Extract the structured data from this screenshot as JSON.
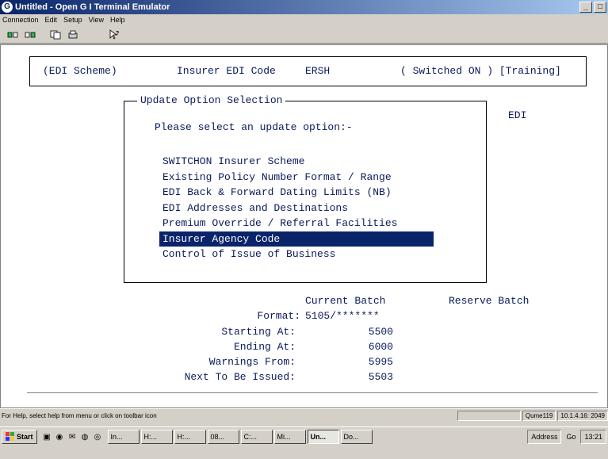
{
  "window": {
    "title": "Untitled - Open G I Terminal Emulator",
    "minimize": "_",
    "maximize": "□"
  },
  "menu": [
    "Connection",
    "Edit",
    "Setup",
    "View",
    "Help"
  ],
  "toolbar": [
    "connect-icon",
    "disconnect-icon",
    "copy-icon",
    "print-icon",
    "help-cursor-icon"
  ],
  "screen": {
    "header": {
      "scheme": "(EDI Scheme)",
      "code_label": "Insurer EDI Code",
      "code": "ERSH",
      "status": "( Switched ON ) [Training]"
    },
    "dialog": {
      "title": "Update Option Selection",
      "prompt": "Please select an update option:-",
      "side_label": "EDI",
      "options": [
        "SWITCHON Insurer Scheme",
        "Existing Policy Number Format / Range",
        "EDI Back & Forward Dating Limits (NB)",
        "EDI Addresses and Destinations",
        "Premium Override / Referral Facilities",
        "Insurer Agency Code",
        "Control of Issue of Business"
      ],
      "selected_index": 5
    },
    "batch": {
      "current_header": "Current Batch",
      "reserve_header": "Reserve Batch",
      "format_label": "Format:",
      "format_value": "5105/*******",
      "rows": [
        {
          "label": "Starting At:",
          "value": "5500"
        },
        {
          "label": "Ending At:",
          "value": "6000"
        },
        {
          "label": "Warnings From:",
          "value": "5995"
        },
        {
          "label": "Next To Be Issued:",
          "value": "5503"
        }
      ]
    }
  },
  "statusbar": {
    "help": "For Help, select help from menu or click on toolbar icon",
    "session": "Qume119",
    "address": "10.1.4.16: 2049"
  },
  "taskbar": {
    "start": "Start",
    "tasks": [
      {
        "label": "In...",
        "active": false
      },
      {
        "label": "H:...",
        "active": false
      },
      {
        "label": "H:...",
        "active": false
      },
      {
        "label": "08...",
        "active": false
      },
      {
        "label": "C:...",
        "active": false
      },
      {
        "label": "Mi...",
        "active": false
      },
      {
        "label": "Un...",
        "active": true
      },
      {
        "label": "Do...",
        "active": false
      }
    ],
    "address_label": "Address",
    "go_label": "Go",
    "clock": "13:21"
  }
}
